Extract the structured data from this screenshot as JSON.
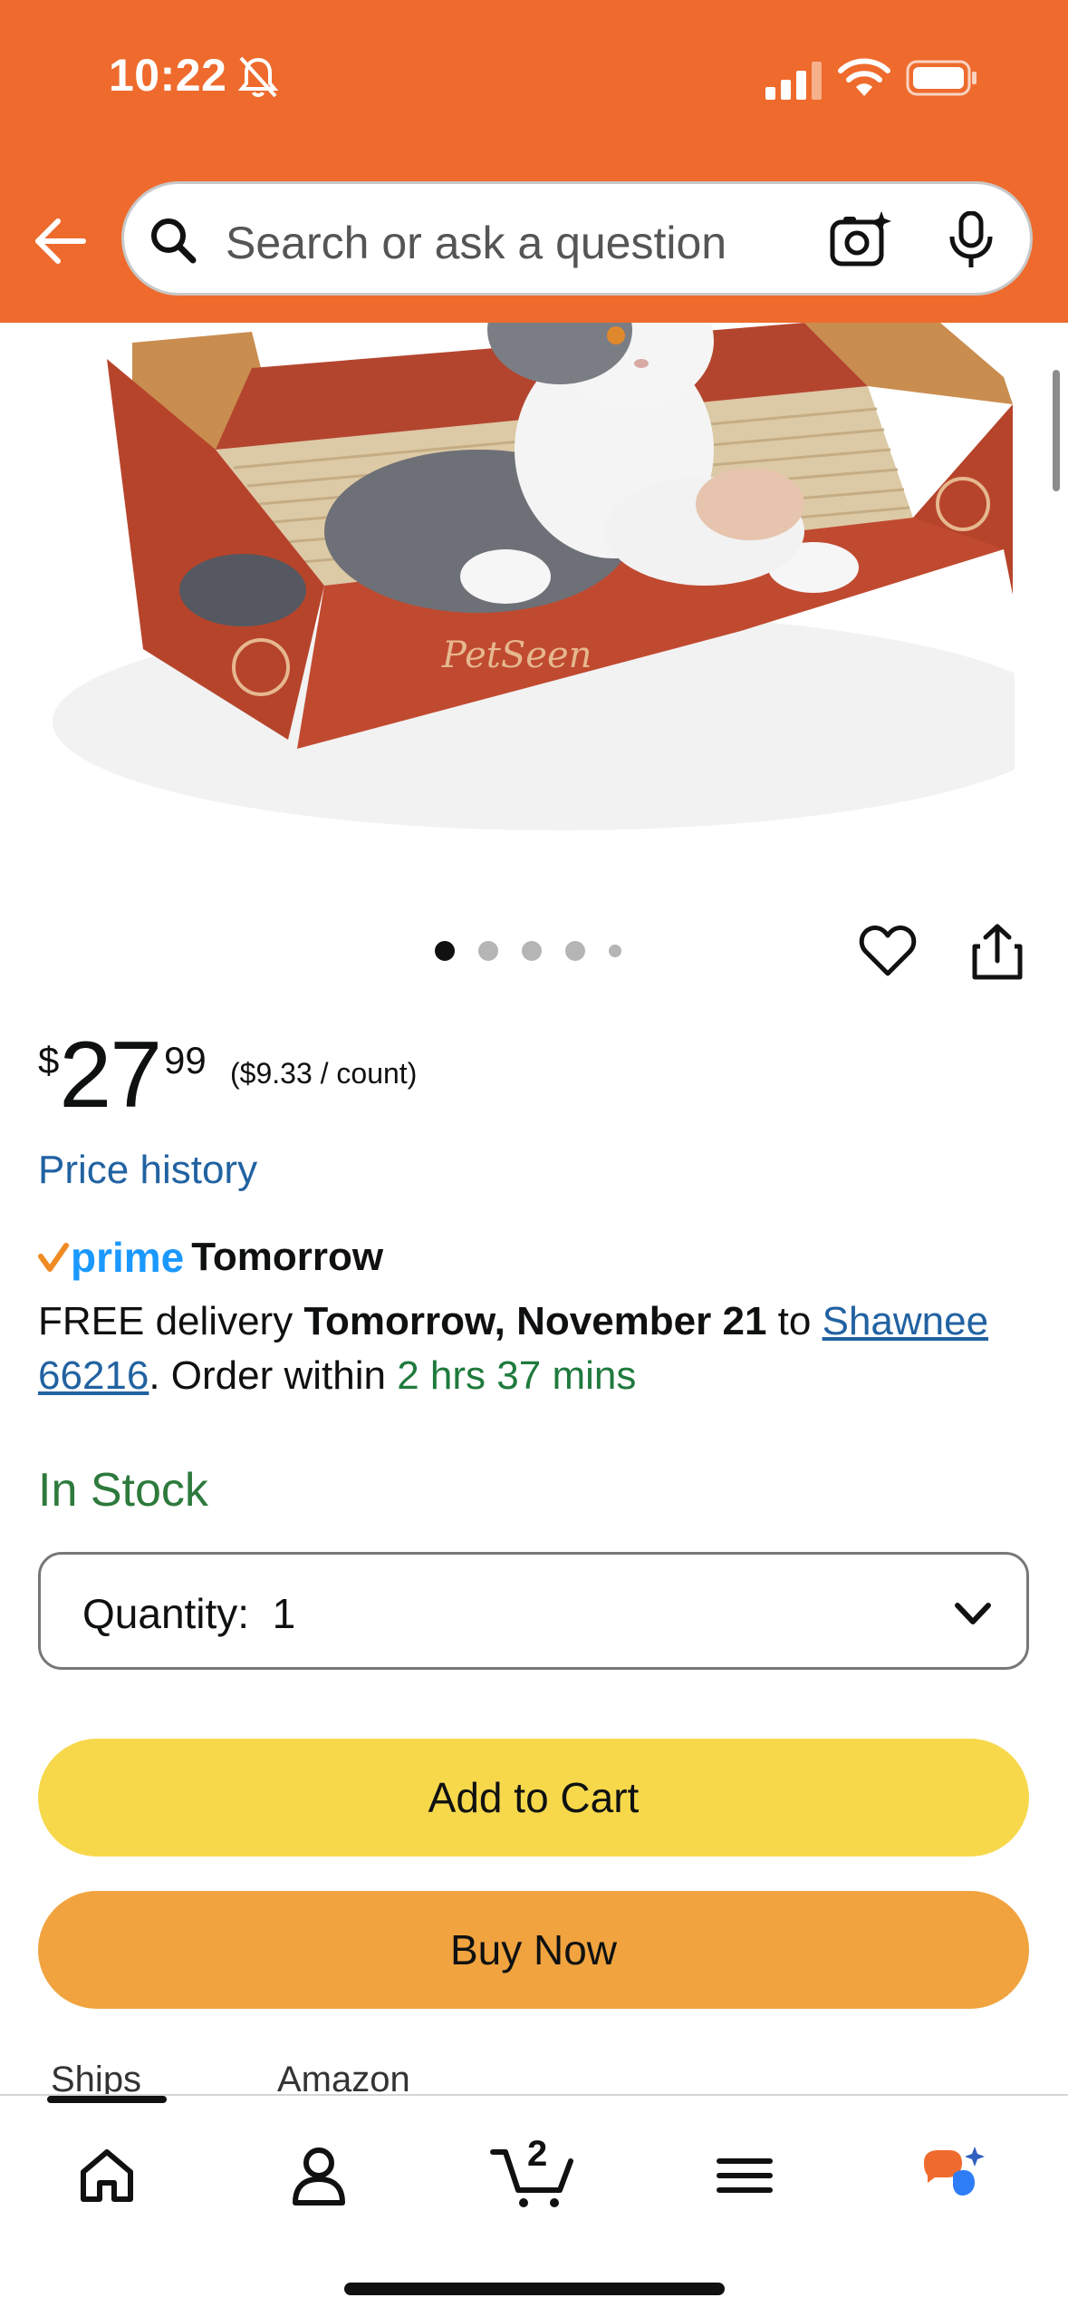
{
  "status_bar": {
    "time": "10:22"
  },
  "search": {
    "placeholder": "Search or ask a question"
  },
  "product": {
    "image_alt": "Cat lying on a cardboard scratcher lounge",
    "brand_on_box": "PetSeen",
    "carousel": {
      "total": 5,
      "active_index": 0
    }
  },
  "price": {
    "currency": "$",
    "whole": "27",
    "fraction": "99",
    "unit_price": "($9.33 / count)",
    "history_label": "Price history"
  },
  "prime": {
    "word": "prime",
    "day": "Tomorrow"
  },
  "delivery": {
    "prefix": "FREE delivery ",
    "date": "Tomorrow, November 21",
    "to": " to ",
    "address": "Shawnee 66216",
    "order_within_prefix": ". Order within ",
    "countdown": "2 hrs 37 mins"
  },
  "stock_status": "In Stock",
  "quantity": {
    "label": "Quantity:",
    "value": "1"
  },
  "buttons": {
    "add_to_cart": "Add to Cart",
    "buy_now": "Buy Now"
  },
  "ships": {
    "label": "Ships from",
    "value": "Amazon"
  },
  "tabbar": {
    "cart_count": "2"
  },
  "colors": {
    "header": "#ee6b2d",
    "add_to_cart": "#f7d84b",
    "buy_now": "#f0a33f",
    "link": "#2162a1",
    "in_stock": "#2d7a3c",
    "prime_blue": "#1a98ff"
  },
  "icons": [
    "bell-off-icon",
    "signal-icon",
    "wifi-icon",
    "battery-icon",
    "back-arrow-icon",
    "search-icon",
    "camera-icon",
    "microphone-icon",
    "heart-icon",
    "share-icon",
    "chevron-down-icon",
    "home-icon",
    "account-icon",
    "cart-icon",
    "menu-icon",
    "rufus-icon"
  ]
}
